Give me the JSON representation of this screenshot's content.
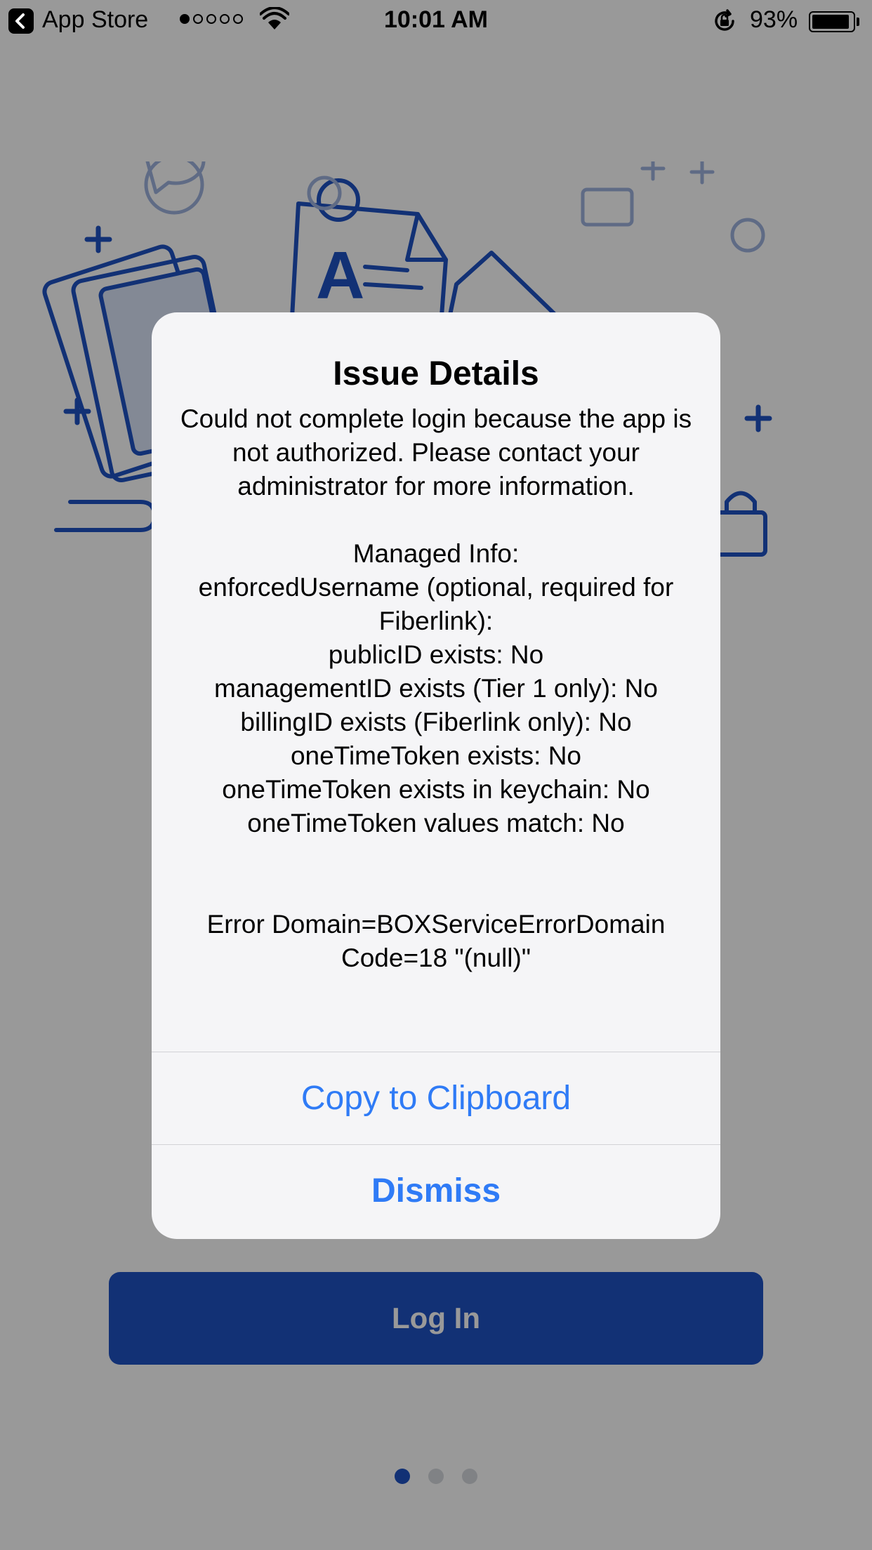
{
  "status_bar": {
    "app_name": "App Store",
    "time": "10:01 AM",
    "battery_percent": "93%",
    "signal_bars_filled": 1,
    "signal_bars_total": 5
  },
  "background": {
    "headline": "",
    "body": "",
    "login_button_label": "Log In",
    "page_count": 3,
    "active_page": 1,
    "accent_color": "#1f52c4"
  },
  "alert": {
    "title": "Issue Details",
    "message": "Could not complete login because the app is not authorized. Please contact your administrator for more information.\n\nManaged Info:\nenforcedUsername (optional, required for Fiberlink):\npublicID exists: No\nmanagementID exists (Tier 1 only): No\nbillingID exists (Fiberlink only): No\noneTimeToken exists: No\noneTimeToken exists in keychain: No\noneTimeToken values match: No\n\n\nError Domain=BOXServiceErrorDomain Code=18 \"(null)\"",
    "copy_button": "Copy to Clipboard",
    "dismiss_button": "Dismiss",
    "button_color": "#2f7bf6"
  }
}
